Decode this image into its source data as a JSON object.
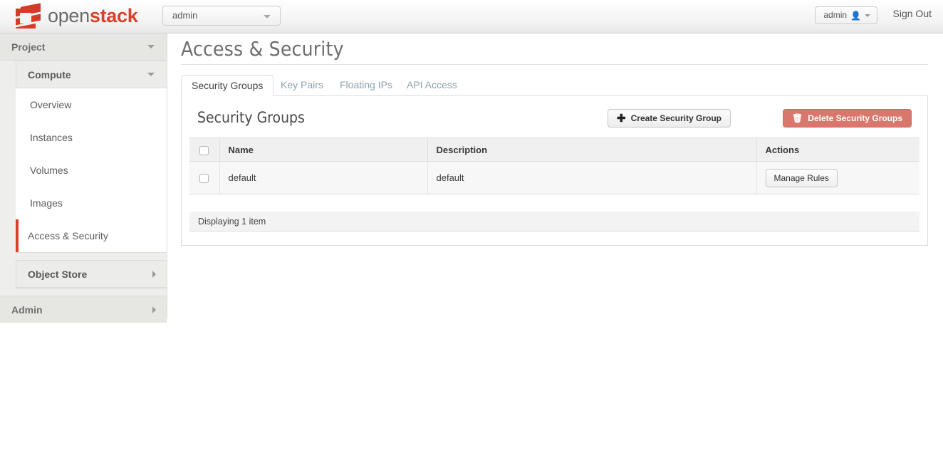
{
  "brand": {
    "logo_open": "open",
    "logo_stack": "stack",
    "logo_icon": "openstack-cube-icon",
    "accent_red": "#d9402a"
  },
  "topbar": {
    "project_selector": {
      "value": "admin",
      "caret_icon": "chevron-down-icon"
    },
    "user_menu": {
      "label": "admin",
      "user_icon": "user-icon",
      "caret_icon": "chevron-down-icon"
    },
    "sign_out": "Sign Out"
  },
  "sidebar": {
    "groups": [
      {
        "label": "Project",
        "expanded": true,
        "icon": "chevron-down-icon"
      }
    ],
    "compute": {
      "label": "Compute",
      "icon": "chevron-down-icon"
    },
    "items": [
      {
        "label": "Overview",
        "active": false
      },
      {
        "label": "Instances",
        "active": false
      },
      {
        "label": "Volumes",
        "active": false
      },
      {
        "label": "Images",
        "active": false
      },
      {
        "label": "Access & Security",
        "active": true
      }
    ],
    "object_store": {
      "label": "Object Store",
      "icon": "chevron-right-icon"
    },
    "admin": {
      "label": "Admin",
      "icon": "chevron-right-icon"
    }
  },
  "main": {
    "page_title": "Access & Security",
    "tabs": [
      {
        "label": "Security Groups",
        "active": true
      },
      {
        "label": "Key Pairs",
        "active": false
      },
      {
        "label": "Floating IPs",
        "active": false
      },
      {
        "label": "API Access",
        "active": false
      }
    ],
    "panel": {
      "title": "Security Groups",
      "create_button": {
        "label": "Create Security Group",
        "icon": "plus-icon",
        "glyph": "✚"
      },
      "delete_button": {
        "label": "Delete Security Groups",
        "icon": "trash-icon",
        "glyph": "🗑",
        "color": "#d9776d"
      },
      "table": {
        "select_all_checkbox": "checkbox-icon",
        "columns": [
          "Name",
          "Description",
          "Actions"
        ],
        "rows": [
          {
            "checkbox": "checkbox-icon",
            "name": "default",
            "description": "default",
            "action_label": "Manage Rules"
          }
        ],
        "footer": "Displaying 1 item"
      }
    }
  }
}
